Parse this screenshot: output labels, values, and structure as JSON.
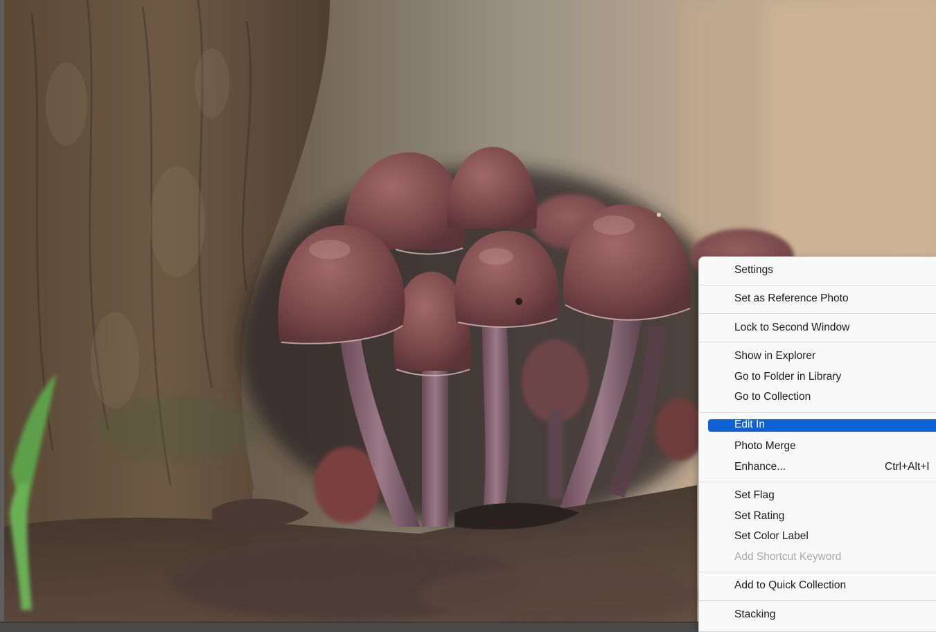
{
  "context_menu": {
    "items": [
      {
        "label": "Settings"
      },
      {
        "label": "Set as Reference Photo"
      },
      {
        "label": "Lock to Second Window"
      },
      {
        "label": "Show in Explorer"
      },
      {
        "label": "Go to Folder in Library"
      },
      {
        "label": "Go to Collection"
      },
      {
        "label": "Edit In",
        "highlighted": true
      },
      {
        "label": "Photo Merge"
      },
      {
        "label": "Enhance...",
        "shortcut": "Ctrl+Alt+I"
      },
      {
        "label": "Set Flag"
      },
      {
        "label": "Set Rating"
      },
      {
        "label": "Set Color Label"
      },
      {
        "label": "Add Shortcut Keyword",
        "disabled": true
      },
      {
        "label": "Add to Quick Collection"
      },
      {
        "label": "Stacking"
      }
    ]
  },
  "colors": {
    "highlight": "#0f5fd6",
    "menu_background": "#f9f9f9",
    "disabled_text": "#a8a8a8"
  }
}
